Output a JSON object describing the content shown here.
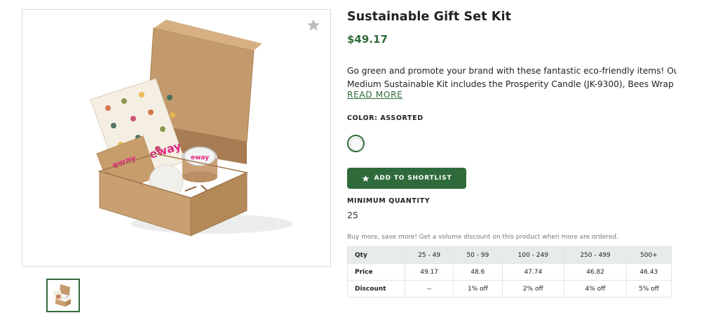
{
  "product": {
    "title": "Sustainable Gift Set Kit",
    "price": "$49.17",
    "description_line1": "Go green and promote your brand with these fantastic eco-friendly items! Our",
    "description_line2": "Medium Sustainable Kit includes the Prosperity Candle (JK-9300), Bees Wrap Singl...",
    "read_more": "READ MORE",
    "color_label": "COLOR: ASSORTED",
    "shortlist_button": "ADD TO SHORTLIST",
    "min_qty_label": "MINIMUM QUANTITY",
    "min_qty_value": "25",
    "volume_note": "Buy more, save more! Get a volume discount on this product when more are ordered.",
    "image_logo_text": "eway",
    "icons": {
      "favorite": "star-icon",
      "shortlist": "star-icon"
    },
    "colors": {
      "brand_green": "#2f6b3a",
      "logo_pink": "#e0267f"
    }
  },
  "pricing_table": {
    "header": [
      "Qty",
      "25 - 49",
      "50 - 99",
      "100 - 249",
      "250 - 499",
      "500+"
    ],
    "rows": [
      [
        "Price",
        "49.17",
        "48.6",
        "47.74",
        "46.82",
        "46.43"
      ],
      [
        "Discount",
        "--",
        "1% off",
        "2% off",
        "4% off",
        "5% off"
      ]
    ]
  }
}
